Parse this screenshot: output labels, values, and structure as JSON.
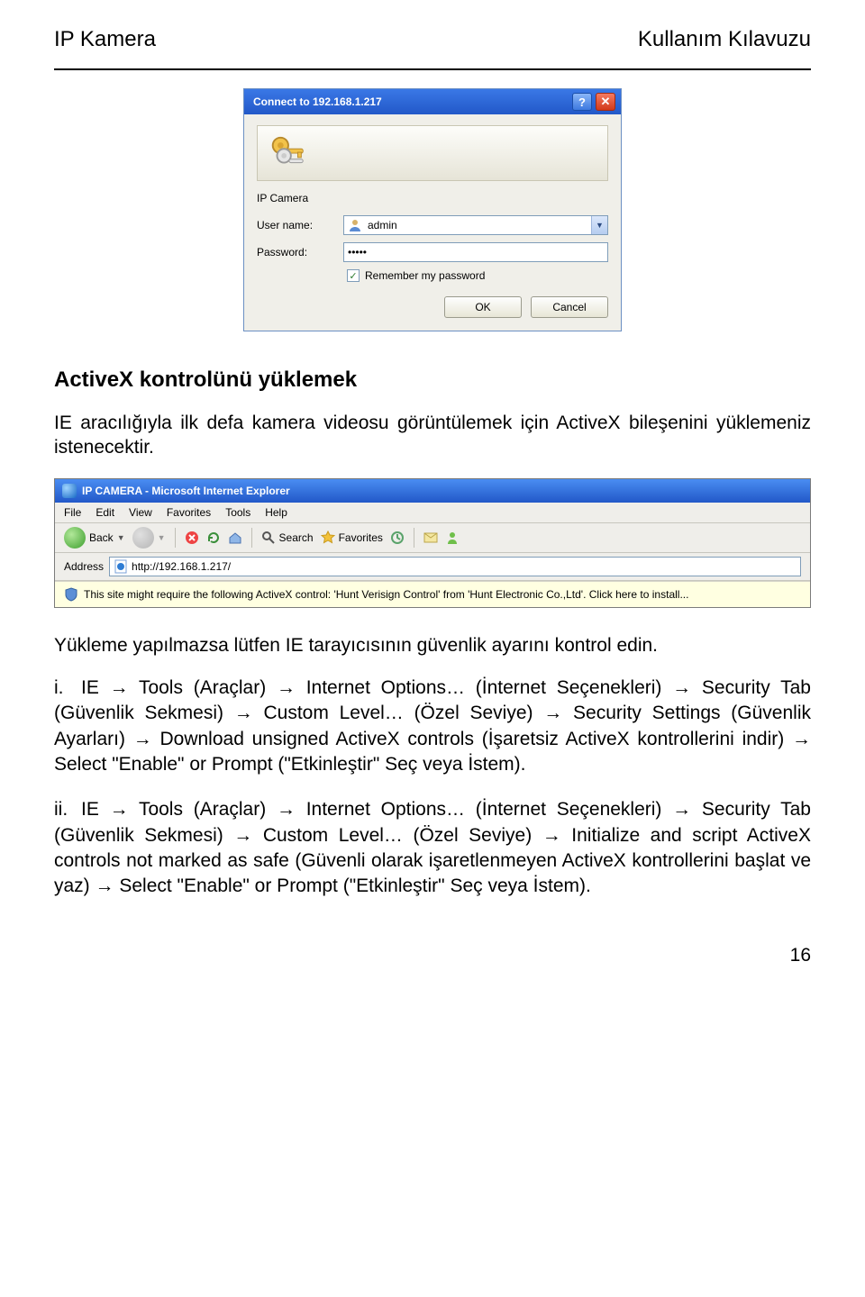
{
  "header": {
    "left": "IP Kamera",
    "right": "Kullanım Kılavuzu"
  },
  "dialog": {
    "title": "Connect to 192.168.1.217",
    "section": "IP Camera",
    "username_label": "User name:",
    "username_value": "admin",
    "password_label": "Password:",
    "password_value": "•••••",
    "remember": "Remember my password",
    "ok": "OK",
    "cancel": "Cancel"
  },
  "section_title": "ActiveX kontrolünü yüklemek",
  "para1": "IE aracılığıyla ilk defa kamera videosu görüntülemek için ActiveX bileşenini yüklemeniz istenecektir.",
  "ie": {
    "title": "IP CAMERA - Microsoft Internet Explorer",
    "menu": [
      "File",
      "Edit",
      "View",
      "Favorites",
      "Tools",
      "Help"
    ],
    "back": "Back",
    "search": "Search",
    "favorites": "Favorites",
    "address_label": "Address",
    "address_value": "http://192.168.1.217/",
    "infobar": "This site might require the following ActiveX control: 'Hunt Verisign Control' from 'Hunt Electronic Co.,Ltd'. Click here to install..."
  },
  "para2": "Yükleme yapılmazsa lütfen IE tarayıcısının güvenlik ayarını kontrol edin.",
  "step1_num": "i.",
  "step1": "IE → Tools (Araçlar) → Internet Options… (İnternet Seçenekleri) → Security Tab (Güvenlik Sekmesi) → Custom Level… (Özel Seviye) → Security Settings (Güvenlik Ayarları) → Download unsigned ActiveX controls (İşaretsiz ActiveX kontrollerini indir) → Select \"Enable\" or Prompt (\"Etkinleştir\" Seç veya İstem).",
  "step2_num": "ii.",
  "step2": "IE → Tools (Araçlar) → Internet Options… (İnternet Seçenekleri) → Security Tab (Güvenlik Sekmesi) → Custom Level… (Özel Seviye) → Initialize and script ActiveX controls not marked as safe (Güvenli olarak işaretlenmeyen ActiveX kontrollerini başlat ve yaz) → Select \"Enable\" or Prompt (\"Etkinleştir\" Seç veya İstem).",
  "page_number": "16"
}
